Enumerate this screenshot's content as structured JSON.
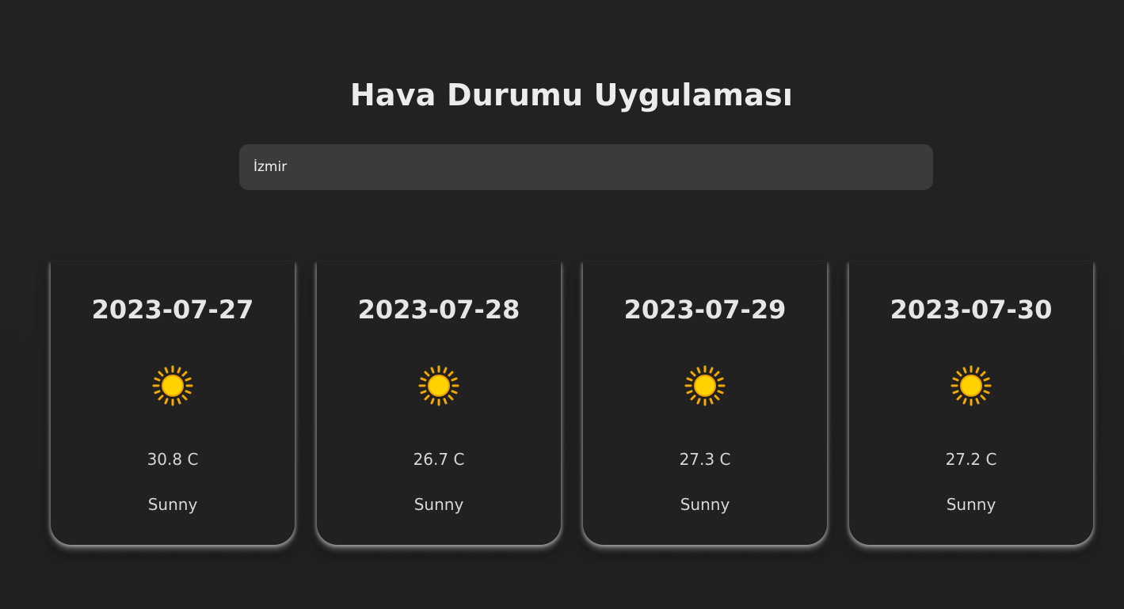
{
  "header": {
    "title": "Hava Durumu Uygulaması"
  },
  "search": {
    "value": "İzmir",
    "placeholder": ""
  },
  "forecast": [
    {
      "date": "2023-07-27",
      "icon": "sun-icon",
      "temperature": "30.8 C",
      "condition": "Sunny"
    },
    {
      "date": "2023-07-28",
      "icon": "sun-icon",
      "temperature": "26.7 C",
      "condition": "Sunny"
    },
    {
      "date": "2023-07-29",
      "icon": "sun-icon",
      "temperature": "27.3 C",
      "condition": "Sunny"
    },
    {
      "date": "2023-07-30",
      "icon": "sun-icon",
      "temperature": "27.2 C",
      "condition": "Sunny"
    }
  ],
  "colors": {
    "background": "#212121",
    "input_background": "#3b3b3b",
    "sun_core": "#ffd200",
    "sun_rays": "#f2a900"
  }
}
